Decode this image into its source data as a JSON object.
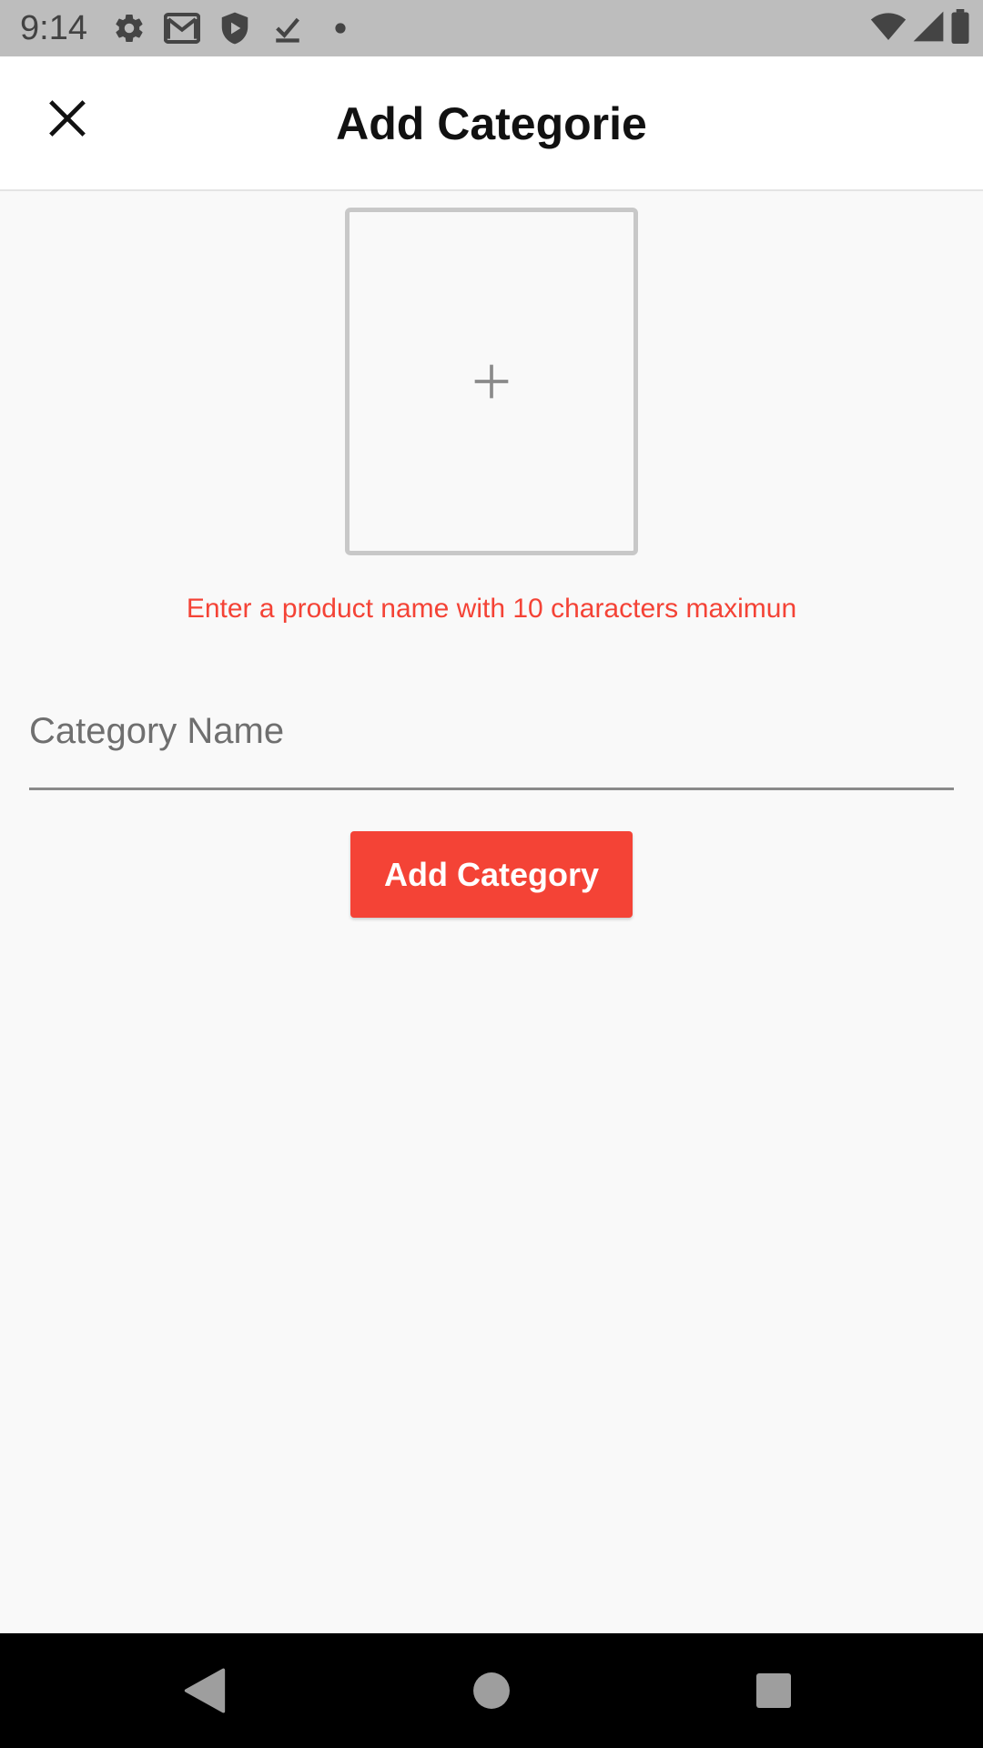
{
  "status_bar": {
    "time": "9:14",
    "icons_left": [
      "settings-icon",
      "gmail-icon",
      "shield-play-icon",
      "download-check-icon",
      "dot-icon"
    ],
    "icons_right": [
      "wifi-icon",
      "signal-icon",
      "battery-icon"
    ]
  },
  "app_bar": {
    "title": "Add Categorie",
    "close_icon": "close-icon"
  },
  "image_picker": {
    "icon": "plus-icon"
  },
  "hint": {
    "text": "Enter a product name with 10 characters maximun",
    "color": "#f44336"
  },
  "form": {
    "category_name": {
      "value": "",
      "placeholder": "Category Name"
    },
    "submit_label": "Add Category"
  },
  "nav_bar": {
    "buttons": [
      "back-icon",
      "home-icon",
      "recents-icon"
    ]
  },
  "colors": {
    "accent": "#f44336",
    "status_bar": "#bdbdbd",
    "background": "#f9f9f9"
  }
}
